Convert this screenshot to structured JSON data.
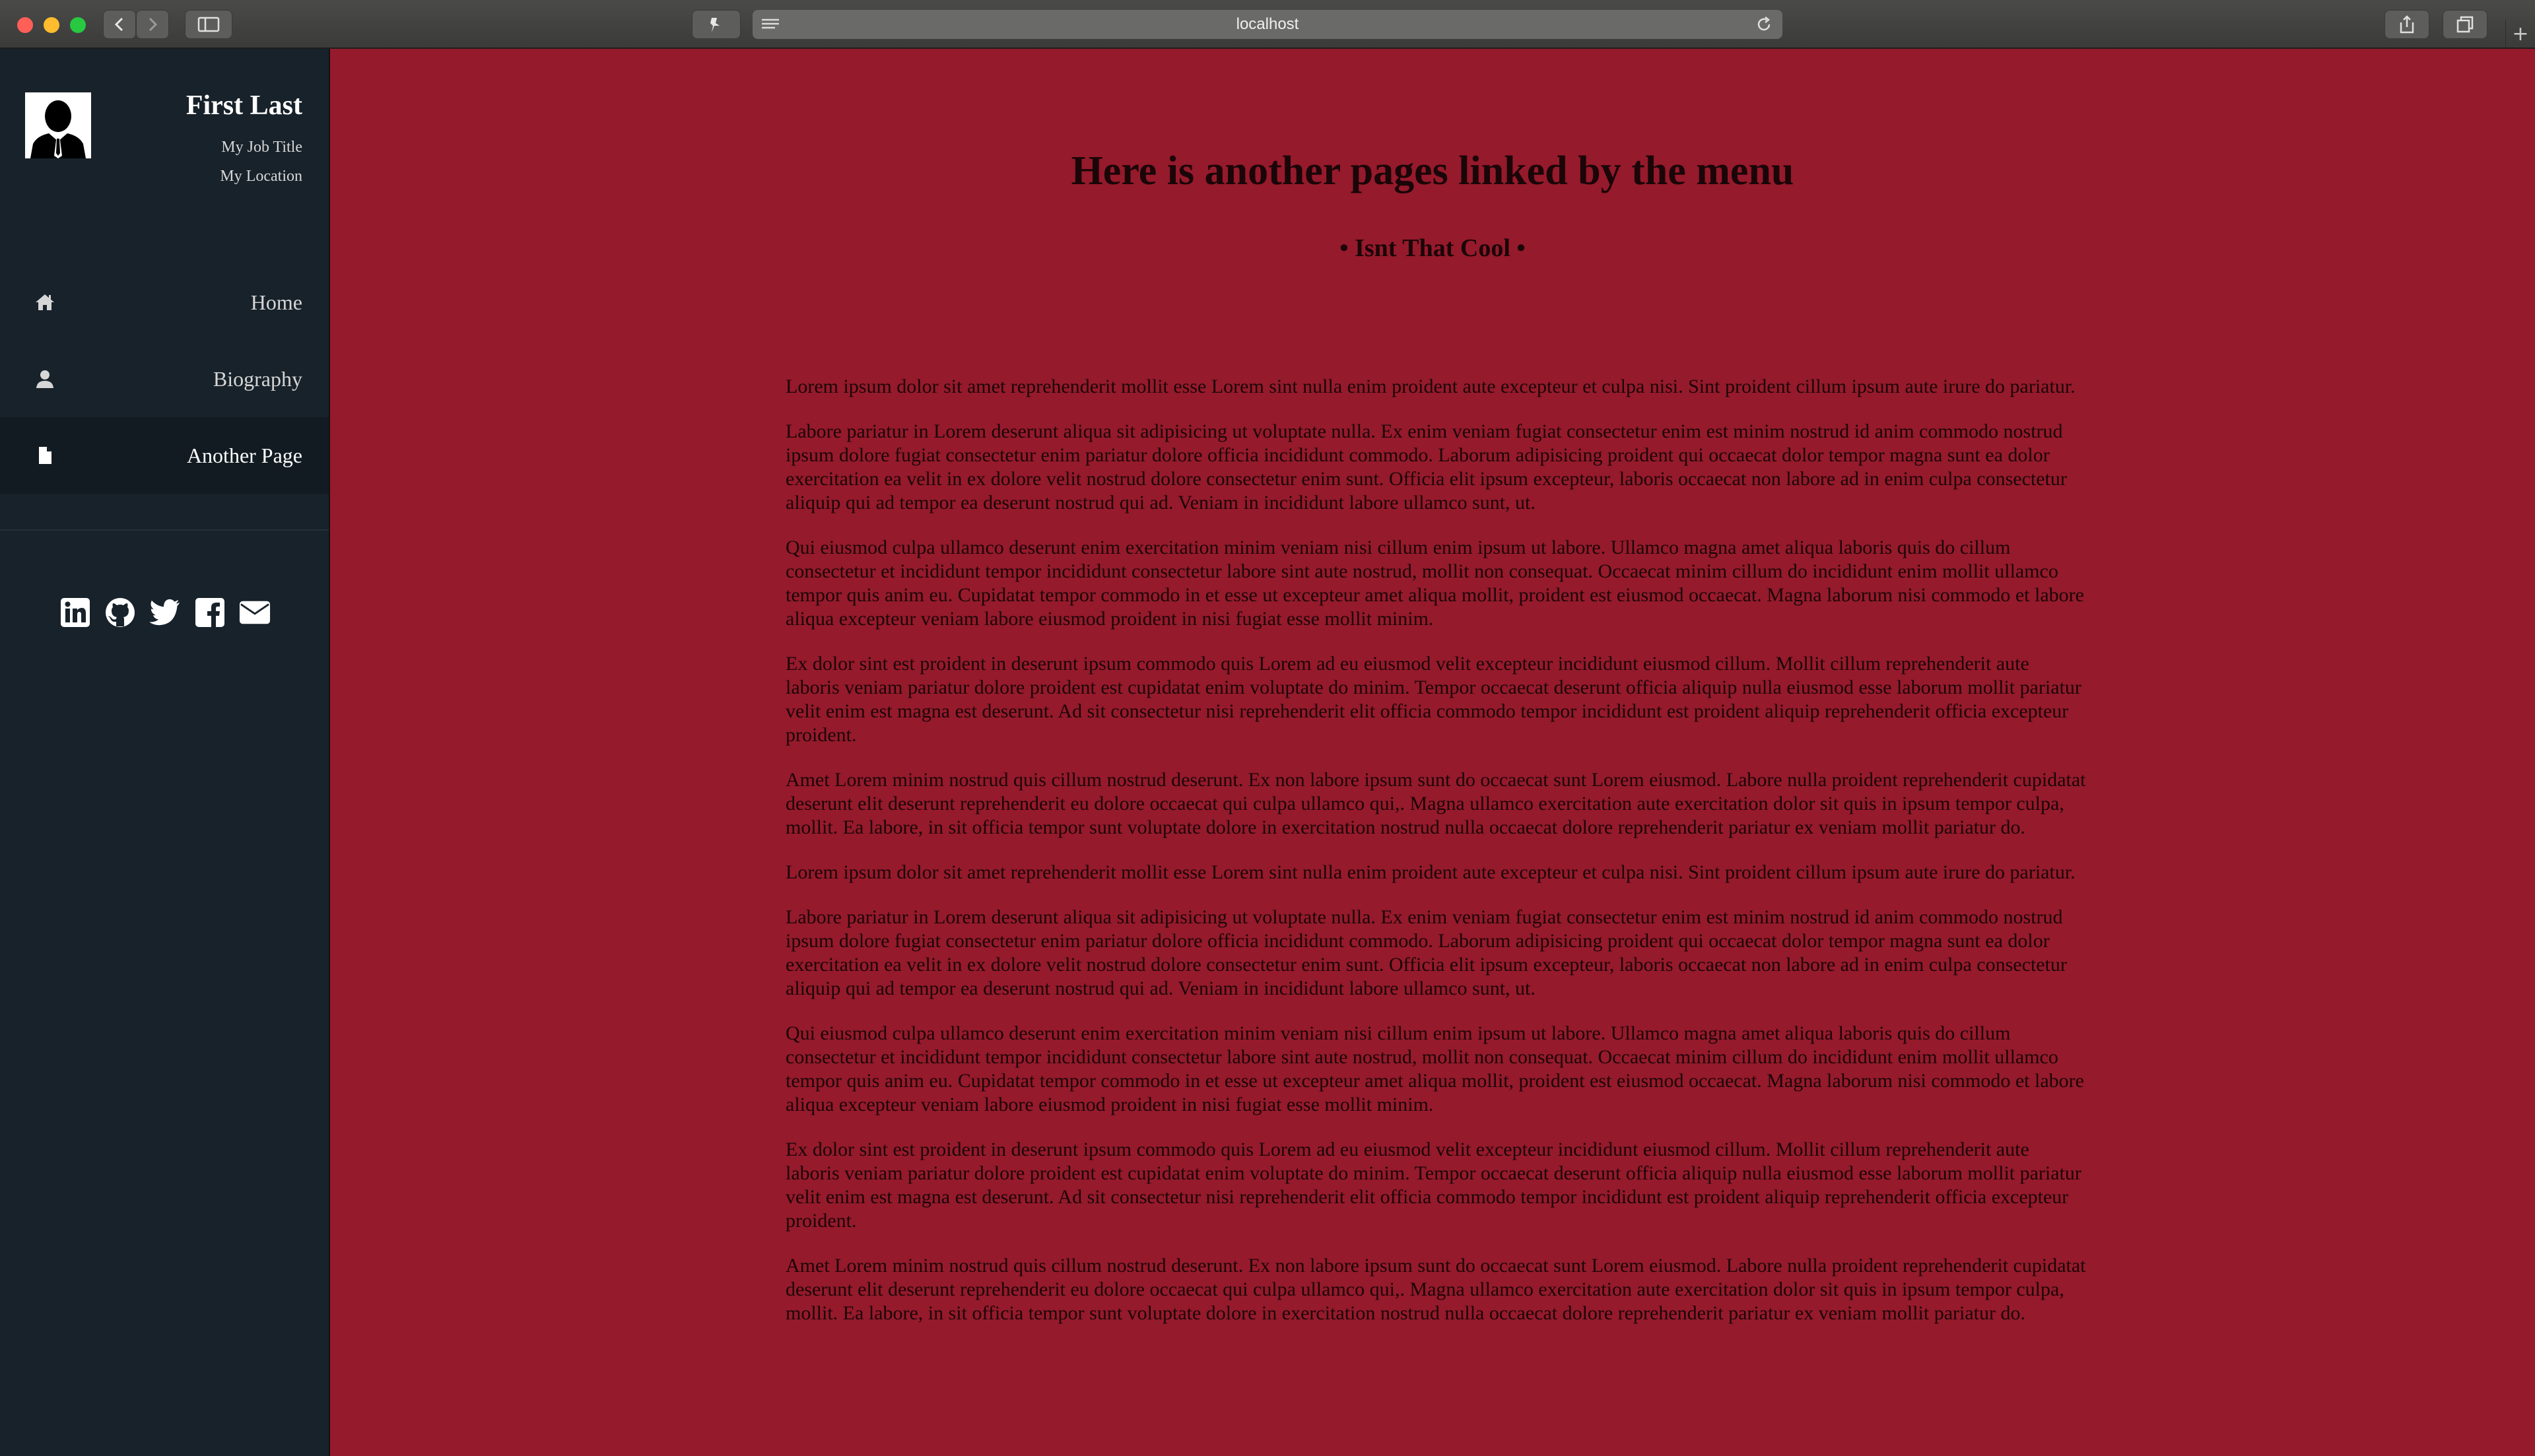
{
  "browser": {
    "address": "localhost"
  },
  "profile": {
    "name": "First Last",
    "job_title": "My Job Title",
    "location": "My Location"
  },
  "nav": [
    {
      "label": "Home",
      "icon": "home-icon"
    },
    {
      "label": "Biography",
      "icon": "user-icon"
    },
    {
      "label": "Another Page",
      "icon": "file-icon",
      "active": true
    }
  ],
  "social": [
    "linkedin-icon",
    "github-icon",
    "twitter-icon",
    "facebook-icon",
    "envelope-icon"
  ],
  "main": {
    "title": "Here is another pages linked by the menu",
    "subtitle": "• Isnt That Cool •",
    "paragraphs": [
      "Lorem ipsum dolor sit amet reprehenderit mollit esse Lorem sint nulla enim proident aute excepteur et culpa nisi. Sint proident cillum ipsum aute irure do pariatur.",
      "Labore pariatur in Lorem deserunt aliqua sit adipisicing ut voluptate nulla. Ex enim veniam fugiat consectetur enim est minim nostrud id anim commodo nostrud ipsum dolore fugiat consectetur enim pariatur dolore officia incididunt commodo. Laborum adipisicing proident qui occaecat dolor tempor magna sunt ea dolor exercitation ea velit in ex dolore velit nostrud dolore consectetur enim sunt. Officia elit ipsum excepteur, laboris occaecat non labore ad in enim culpa consectetur aliquip qui ad tempor ea deserunt nostrud qui ad. Veniam in incididunt labore ullamco sunt, ut.",
      "Qui eiusmod culpa ullamco deserunt enim exercitation minim veniam nisi cillum enim ipsum ut labore. Ullamco magna amet aliqua laboris quis do cillum consectetur et incididunt tempor incididunt consectetur labore sint aute nostrud, mollit non consequat. Occaecat minim cillum do incididunt enim mollit ullamco tempor quis anim eu. Cupidatat tempor commodo in et esse ut excepteur amet aliqua mollit, proident est eiusmod occaecat. Magna laborum nisi commodo et labore aliqua excepteur veniam labore eiusmod proident in nisi fugiat esse mollit minim.",
      "Ex dolor sint est proident in deserunt ipsum commodo quis Lorem ad eu eiusmod velit excepteur incididunt eiusmod cillum. Mollit cillum reprehenderit aute laboris veniam pariatur dolore proident est cupidatat enim voluptate do minim. Tempor occaecat deserunt officia aliquip nulla eiusmod esse laborum mollit pariatur velit enim est magna est deserunt. Ad sit consectetur nisi reprehenderit elit officia commodo tempor incididunt est proident aliquip reprehenderit officia excepteur proident.",
      "Amet Lorem minim nostrud quis cillum nostrud deserunt. Ex non labore ipsum sunt do occaecat sunt Lorem eiusmod. Labore nulla proident reprehenderit cupidatat deserunt elit deserunt reprehenderit eu dolore occaecat qui culpa ullamco qui,. Magna ullamco exercitation aute exercitation dolor sit quis in ipsum tempor culpa, mollit. Ea labore, in sit officia tempor sunt voluptate dolore in exercitation nostrud nulla occaecat dolore reprehenderit pariatur ex veniam mollit pariatur do.",
      "Lorem ipsum dolor sit amet reprehenderit mollit esse Lorem sint nulla enim proident aute excepteur et culpa nisi. Sint proident cillum ipsum aute irure do pariatur.",
      "Labore pariatur in Lorem deserunt aliqua sit adipisicing ut voluptate nulla. Ex enim veniam fugiat consectetur enim est minim nostrud id anim commodo nostrud ipsum dolore fugiat consectetur enim pariatur dolore officia incididunt commodo. Laborum adipisicing proident qui occaecat dolor tempor magna sunt ea dolor exercitation ea velit in ex dolore velit nostrud dolore consectetur enim sunt. Officia elit ipsum excepteur, laboris occaecat non labore ad in enim culpa consectetur aliquip qui ad tempor ea deserunt nostrud qui ad. Veniam in incididunt labore ullamco sunt, ut.",
      "Qui eiusmod culpa ullamco deserunt enim exercitation minim veniam nisi cillum enim ipsum ut labore. Ullamco magna amet aliqua laboris quis do cillum consectetur et incididunt tempor incididunt consectetur labore sint aute nostrud, mollit non consequat. Occaecat minim cillum do incididunt enim mollit ullamco tempor quis anim eu. Cupidatat tempor commodo in et esse ut excepteur amet aliqua mollit, proident est eiusmod occaecat. Magna laborum nisi commodo et labore aliqua excepteur veniam labore eiusmod proident in nisi fugiat esse mollit minim.",
      "Ex dolor sint est proident in deserunt ipsum commodo quis Lorem ad eu eiusmod velit excepteur incididunt eiusmod cillum. Mollit cillum reprehenderit aute laboris veniam pariatur dolore proident est cupidatat enim voluptate do minim. Tempor occaecat deserunt officia aliquip nulla eiusmod esse laborum mollit pariatur velit enim est magna est deserunt. Ad sit consectetur nisi reprehenderit elit officia commodo tempor incididunt est proident aliquip reprehenderit officia excepteur proident.",
      "Amet Lorem minim nostrud quis cillum nostrud deserunt. Ex non labore ipsum sunt do occaecat sunt Lorem eiusmod. Labore nulla proident reprehenderit cupidatat deserunt elit deserunt reprehenderit eu dolore occaecat qui culpa ullamco qui,. Magna ullamco exercitation aute exercitation dolor sit quis in ipsum tempor culpa, mollit. Ea labore, in sit officia tempor sunt voluptate dolore in exercitation nostrud nulla occaecat dolore reprehenderit pariatur ex veniam mollit pariatur do."
    ]
  },
  "colors": {
    "sidebar_bg": "#18222a",
    "main_bg": "#951a2b",
    "text_dark": "#1a0508"
  }
}
